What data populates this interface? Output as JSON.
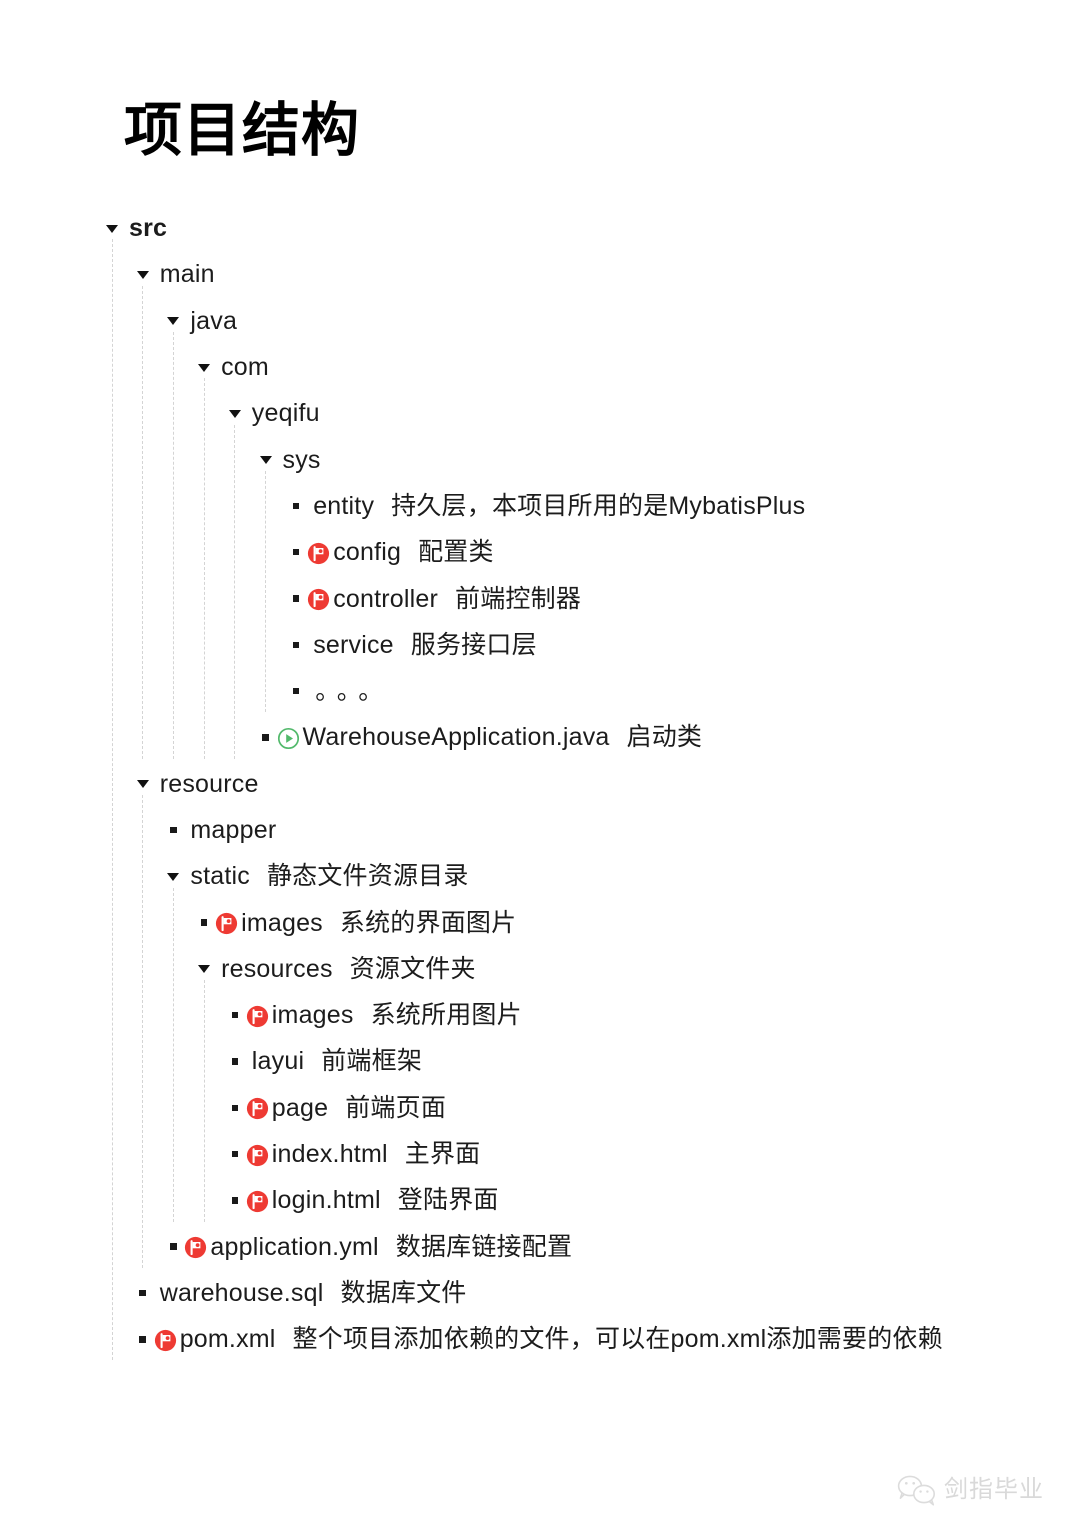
{
  "page": {
    "title": "项目结构",
    "background": "#ffffff",
    "text_color": "#1c1c1c"
  },
  "icons": {
    "red_flag": {
      "name": "red-flag-icon",
      "color": "#ee3a33"
    },
    "green_run": {
      "name": "green-run-icon",
      "color": "#52b96b"
    },
    "wechat": {
      "name": "wechat-icon",
      "color": "#d9d9d9"
    }
  },
  "tree": {
    "rows": [
      {
        "depth": 0,
        "marker": "triangle",
        "icon": null,
        "label": "src",
        "bold": true,
        "desc": ""
      },
      {
        "depth": 1,
        "marker": "triangle",
        "icon": null,
        "label": "main",
        "bold": false,
        "desc": ""
      },
      {
        "depth": 2,
        "marker": "triangle",
        "icon": null,
        "label": "java",
        "bold": false,
        "desc": ""
      },
      {
        "depth": 3,
        "marker": "triangle",
        "icon": null,
        "label": "com",
        "bold": false,
        "desc": ""
      },
      {
        "depth": 4,
        "marker": "triangle",
        "icon": null,
        "label": "yeqifu",
        "bold": false,
        "desc": ""
      },
      {
        "depth": 5,
        "marker": "triangle",
        "icon": null,
        "label": "sys",
        "bold": false,
        "desc": ""
      },
      {
        "depth": 6,
        "marker": "square",
        "icon": null,
        "label": "entity",
        "bold": false,
        "desc": "持久层，本项目所用的是MybatisPlus"
      },
      {
        "depth": 6,
        "marker": "square",
        "icon": "red_flag",
        "label": "config",
        "bold": false,
        "desc": "配置类"
      },
      {
        "depth": 6,
        "marker": "square",
        "icon": "red_flag",
        "label": "controller",
        "bold": false,
        "desc": "前端控制器"
      },
      {
        "depth": 6,
        "marker": "square",
        "icon": null,
        "label": "service",
        "bold": false,
        "desc": "服务接口层"
      },
      {
        "depth": 6,
        "marker": "square",
        "icon": null,
        "label": "",
        "bold": false,
        "desc": "",
        "dots": "。。。"
      },
      {
        "depth": 5,
        "marker": "square",
        "icon": "green_run",
        "label": "WarehouseApplication.java",
        "bold": false,
        "desc": "启动类"
      },
      {
        "depth": 1,
        "marker": "triangle",
        "icon": null,
        "label": "resource",
        "bold": false,
        "desc": ""
      },
      {
        "depth": 2,
        "marker": "square",
        "icon": null,
        "label": "mapper",
        "bold": false,
        "desc": ""
      },
      {
        "depth": 2,
        "marker": "triangle",
        "icon": null,
        "label": "static",
        "bold": false,
        "desc": "静态文件资源目录"
      },
      {
        "depth": 3,
        "marker": "square",
        "icon": "red_flag",
        "label": "images",
        "bold": false,
        "desc": "系统的界面图片"
      },
      {
        "depth": 3,
        "marker": "triangle",
        "icon": null,
        "label": "resources",
        "bold": false,
        "desc": "资源文件夹"
      },
      {
        "depth": 4,
        "marker": "square",
        "icon": "red_flag",
        "label": "images",
        "bold": false,
        "desc": "系统所用图片"
      },
      {
        "depth": 4,
        "marker": "square",
        "icon": null,
        "label": "layui",
        "bold": false,
        "desc": "前端框架"
      },
      {
        "depth": 4,
        "marker": "square",
        "icon": "red_flag",
        "label": "page",
        "bold": false,
        "desc": "前端页面"
      },
      {
        "depth": 4,
        "marker": "square",
        "icon": "red_flag",
        "label": "index.html",
        "bold": false,
        "desc": "主界面"
      },
      {
        "depth": 4,
        "marker": "square",
        "icon": "red_flag",
        "label": "login.html",
        "bold": false,
        "desc": "登陆界面"
      },
      {
        "depth": 2,
        "marker": "square",
        "icon": "red_flag",
        "label": "application.yml",
        "bold": false,
        "desc": "数据库链接配置"
      },
      {
        "depth": 1,
        "marker": "square",
        "icon": null,
        "label": "warehouse.sql",
        "bold": false,
        "desc": "数据库文件"
      },
      {
        "depth": 1,
        "marker": "square",
        "icon": "red_flag",
        "label": "pom.xml",
        "bold": false,
        "desc": "整个项目添加依赖的文件，可以在pom.xml添加需要的依赖"
      }
    ]
  },
  "footer": {
    "watermark_text": "剑指毕业"
  }
}
